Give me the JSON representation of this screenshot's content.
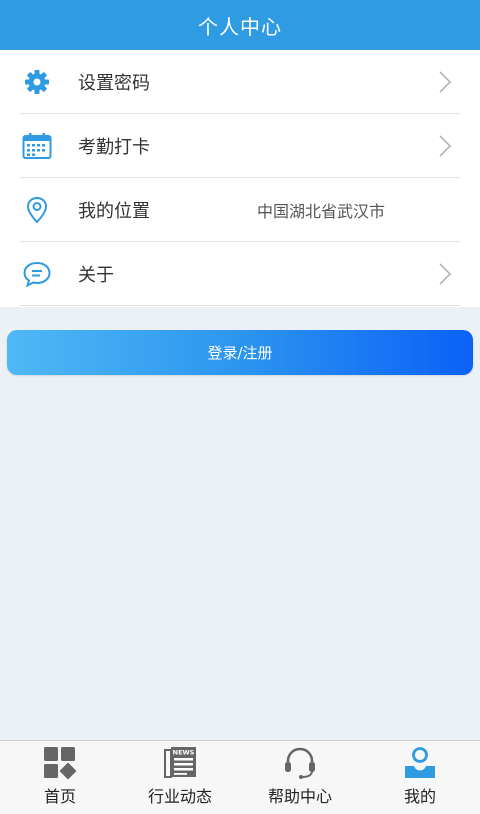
{
  "header": {
    "title": "个人中心"
  },
  "menu": [
    {
      "label": "设置密码",
      "icon": "gear-icon",
      "chevron": true
    },
    {
      "label": "考勤打卡",
      "icon": "calendar-icon",
      "chevron": true
    },
    {
      "label": "我的位置",
      "icon": "location-pin-icon",
      "value": "中国湖北省武汉市"
    },
    {
      "label": "关于",
      "icon": "chat-bubble-icon",
      "chevron": true
    }
  ],
  "login_button": {
    "label": "登录/注册"
  },
  "tabbar": {
    "items": [
      {
        "label": "首页",
        "icon": "home-grid-icon"
      },
      {
        "label": "行业动态",
        "icon": "news-icon"
      },
      {
        "label": "帮助中心",
        "icon": "headset-icon"
      },
      {
        "label": "我的",
        "icon": "user-icon",
        "active": true
      }
    ]
  },
  "colors": {
    "header_bg": "#2e9be3",
    "icon_blue": "#2e9be3",
    "tab_gray": "#666666",
    "tab_active": "#2e9be3",
    "page_bg": "#ecf1f5"
  }
}
